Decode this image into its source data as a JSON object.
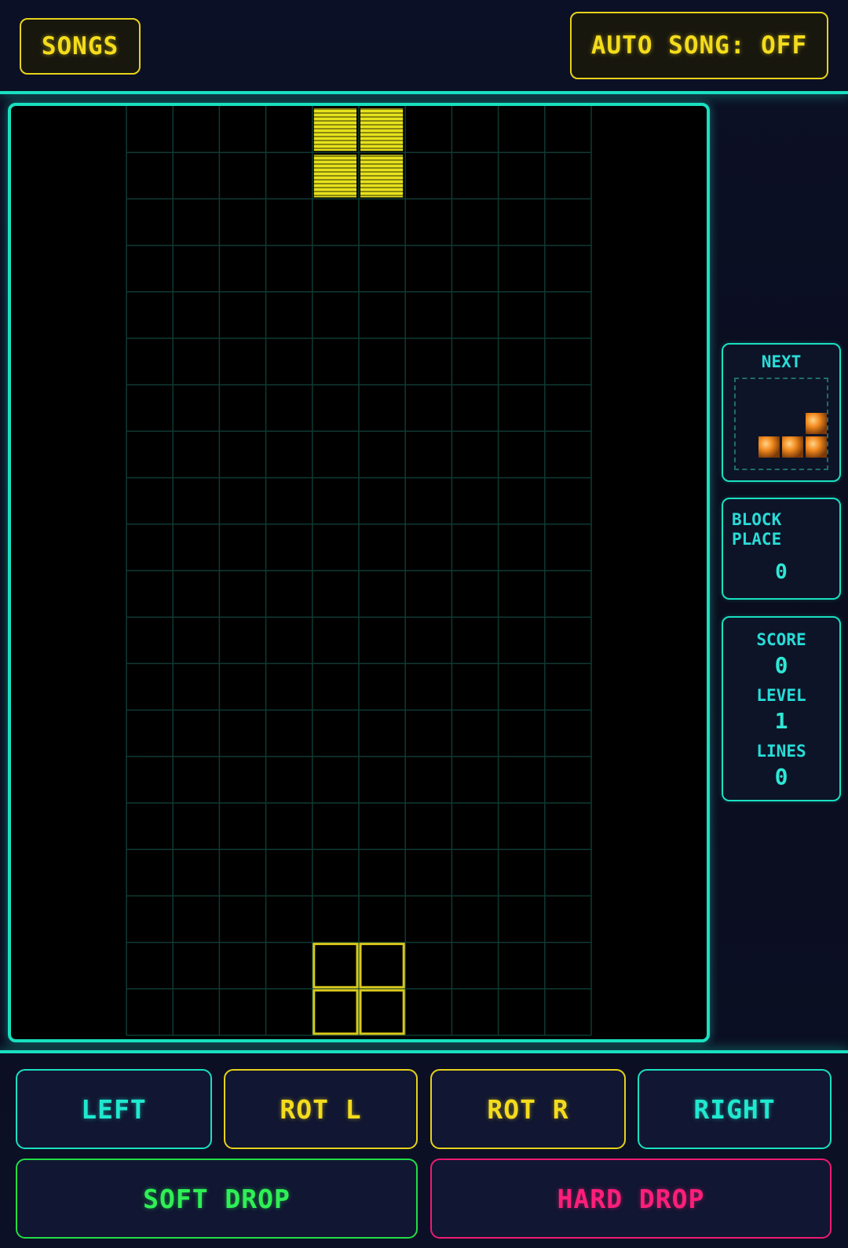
{
  "header": {
    "songs_label": "SONGS",
    "auto_song_label": "AUTO SONG: OFF"
  },
  "board": {
    "columns": 10,
    "rows": 20,
    "active_piece": {
      "type": "O",
      "color": "#e6e21c",
      "cells": [
        [
          4,
          0
        ],
        [
          5,
          0
        ],
        [
          4,
          1
        ],
        [
          5,
          1
        ]
      ]
    },
    "ghost_piece": {
      "color": "#d8c81a",
      "cells": [
        [
          4,
          18
        ],
        [
          5,
          18
        ],
        [
          4,
          19
        ],
        [
          5,
          19
        ]
      ]
    },
    "grid_color": "#0f3a32"
  },
  "next_panel": {
    "title": "NEXT",
    "piece": {
      "type": "L",
      "color": "#f28a1e",
      "cells": [
        [
          2,
          0
        ],
        [
          0,
          1
        ],
        [
          1,
          1
        ],
        [
          2,
          1
        ]
      ]
    }
  },
  "block_place": {
    "title": "BLOCK PLACE",
    "value": "0"
  },
  "stats": {
    "score_label": "SCORE",
    "score_value": "0",
    "level_label": "LEVEL",
    "level_value": "1",
    "lines_label": "LINES",
    "lines_value": "0"
  },
  "controls": {
    "left_label": "LEFT",
    "rot_l_label": "ROT L",
    "rot_r_label": "ROT R",
    "right_label": "RIGHT",
    "soft_drop_label": "SOFT DROP",
    "hard_drop_label": "HARD DROP"
  }
}
